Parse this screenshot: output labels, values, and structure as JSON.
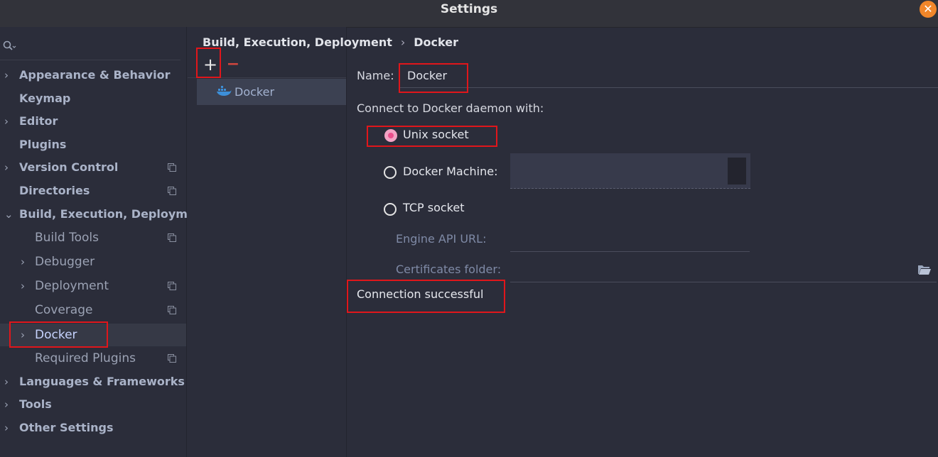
{
  "window": {
    "title": "Settings"
  },
  "search": {
    "icon": "search-icon"
  },
  "sidebar": {
    "items": [
      {
        "label": "Appearance & Behavior",
        "expandable": true
      },
      {
        "label": "Keymap"
      },
      {
        "label": "Editor",
        "expandable": true
      },
      {
        "label": "Plugins"
      },
      {
        "label": "Version Control",
        "expandable": true,
        "project_icon": true
      },
      {
        "label": "Directories",
        "project_icon": true
      },
      {
        "label": "Build, Execution, Deployment",
        "expanded": true
      },
      {
        "label": "Build Tools",
        "project_icon": true
      },
      {
        "label": "Debugger",
        "expandable": true
      },
      {
        "label": "Deployment",
        "expandable": true,
        "project_icon": true
      },
      {
        "label": "Coverage",
        "project_icon": true
      },
      {
        "label": "Docker",
        "expandable": true,
        "selected": true
      },
      {
        "label": "Required Plugins",
        "project_icon": true
      },
      {
        "label": "Languages & Frameworks",
        "expandable": true
      },
      {
        "label": "Tools",
        "expandable": true
      },
      {
        "label": "Other Settings",
        "expandable": true
      }
    ]
  },
  "breadcrumb": {
    "parent": "Build, Execution, Deployment",
    "separator": "›",
    "current": "Docker"
  },
  "toolbar": {
    "add_label": "+",
    "remove_label": "−"
  },
  "server_list": {
    "items": [
      {
        "label": "Docker",
        "icon": "docker-icon"
      }
    ]
  },
  "form": {
    "name_label": "Name:",
    "name_value": "Docker",
    "connect_label": "Connect to Docker daemon with:",
    "options": [
      {
        "label": "Unix socket",
        "checked": true
      },
      {
        "label": "Docker Machine:",
        "checked": false
      },
      {
        "label": "TCP socket",
        "checked": false
      }
    ],
    "engine_api_label": "Engine API URL:",
    "certs_label": "Certificates folder:",
    "status": "Connection successful"
  },
  "colors": {
    "accent_radio": "#ea4f8c",
    "highlight": "#e0161b",
    "close": "#f0862a"
  }
}
